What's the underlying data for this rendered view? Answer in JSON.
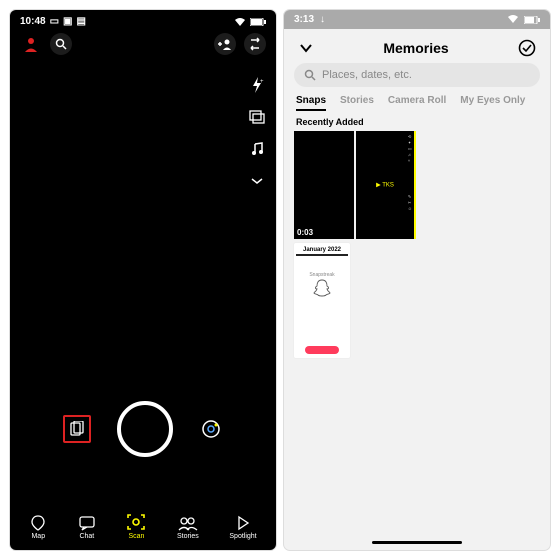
{
  "left": {
    "status_time": "10:48",
    "profile_icon": "profile",
    "nav": {
      "map": "Map",
      "chat": "Chat",
      "scan": "Scan",
      "stories": "Stories",
      "spotlight": "Spotlight"
    }
  },
  "right": {
    "status_time": "3:13",
    "title": "Memories",
    "search_placeholder": "Places, dates, etc.",
    "tabs": {
      "snaps": "Snaps",
      "stories": "Stories",
      "camera_roll": "Camera Roll",
      "my_eyes": "My Eyes Only"
    },
    "section1": "Recently Added",
    "thumb_duration": "0:03",
    "thumb_tag": "▶  TKS",
    "section2": "January 2022",
    "ghost_caption": "Snapstreak"
  }
}
